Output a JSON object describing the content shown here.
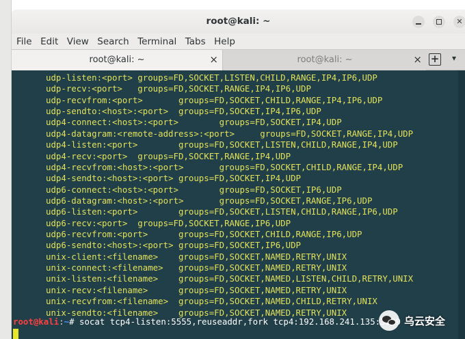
{
  "window": {
    "title": "root@kali: ~"
  },
  "menu": [
    "File",
    "Edit",
    "View",
    "Search",
    "Terminal",
    "Tabs",
    "Help"
  ],
  "tabs": [
    {
      "label": "root@kali: ~",
      "close": "×",
      "active": true
    },
    {
      "label": "root@kali: ~",
      "close": "×",
      "active": false
    }
  ],
  "tab_actions": {
    "new_tab": "+",
    "menu": "▾"
  },
  "terminal": {
    "lines": [
      "udp-listen:<port> groups=FD,SOCKET,LISTEN,CHILD,RANGE,IP4,IP6,UDP",
      "udp-recv:<port>   groups=FD,SOCKET,RANGE,IP4,IP6,UDP",
      "udp-recvfrom:<port>       groups=FD,SOCKET,CHILD,RANGE,IP4,IP6,UDP",
      "udp-sendto:<host>:<port>  groups=FD,SOCKET,IP4,IP6,UDP",
      "udp4-connect:<host>:<port>        groups=FD,SOCKET,IP4,UDP",
      "udp4-datagram:<remote-address>:<port>     groups=FD,SOCKET,RANGE,IP4,UDP",
      "udp4-listen:<port>        groups=FD,SOCKET,LISTEN,CHILD,RANGE,IP4,UDP",
      "udp4-recv:<port>  groups=FD,SOCKET,RANGE,IP4,UDP",
      "udp4-recvfrom:<host>:<port>       groups=FD,SOCKET,CHILD,RANGE,IP4,UDP",
      "udp4-sendto:<host>:<port> groups=FD,SOCKET,IP4,UDP",
      "udp6-connect:<host>:<port>        groups=FD,SOCKET,IP6,UDP",
      "udp6-datagram:<host>:<port>       groups=FD,SOCKET,RANGE,IP6,UDP",
      "udp6-listen:<port>        groups=FD,SOCKET,LISTEN,CHILD,RANGE,IP6,UDP",
      "udp6-recv:<port>  groups=FD,SOCKET,RANGE,IP6,UDP",
      "udp6-recvfrom:<port>      groups=FD,SOCKET,CHILD,RANGE,IP6,UDP",
      "udp6-sendto:<host>:<port> groups=FD,SOCKET,IP6,UDP",
      "unix-client:<filename>    groups=FD,SOCKET,NAMED,RETRY,UNIX",
      "unix-connect:<filename>   groups=FD,SOCKET,NAMED,RETRY,UNIX",
      "unix-listen:<filename>    groups=FD,SOCKET,NAMED,LISTEN,CHILD,RETRY,UNIX",
      "unix-recv:<filename>      groups=FD,SOCKET,NAMED,RETRY,UNIX",
      "unix-recvfrom:<filename>  groups=FD,SOCKET,NAMED,CHILD,RETRY,UNIX",
      "unix-sendto:<filename>    groups=FD,SOCKET,NAMED,RETRY,UNIX"
    ],
    "prompt_user": "root@kali",
    "prompt_sep": ":",
    "prompt_dir": "~",
    "prompt_command": "# socat tcp4-listen:5555,reuseaddr,fork tcp4:192.168.241.135:3389"
  },
  "watermark": {
    "text": "乌云安全",
    "icon": "wechat-icon"
  },
  "colors": {
    "terminal_bg": "#213f49",
    "terminal_text": "#e2e25a",
    "prompt_user": "#ff4040",
    "prompt_dir": "#4f8ffc"
  }
}
